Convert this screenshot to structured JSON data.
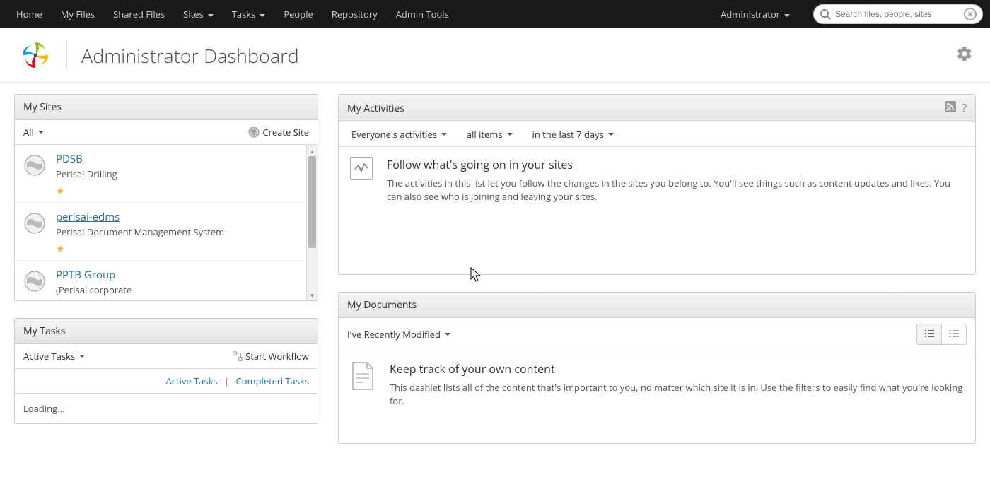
{
  "nav": {
    "home": "Home",
    "myFiles": "My Files",
    "sharedFiles": "Shared Files",
    "sites": "Sites",
    "tasks": "Tasks",
    "people": "People",
    "repository": "Repository",
    "adminTools": "Admin Tools",
    "user": "Administrator",
    "searchPlaceholder": "Search files, people, sites"
  },
  "header": {
    "title": "Administrator Dashboard"
  },
  "mySites": {
    "title": "My Sites",
    "filter": "All",
    "createSite": "Create Site",
    "items": [
      {
        "name": "PDSB",
        "desc": "Perisai Drilling"
      },
      {
        "name": "perisai-edms",
        "desc": "Perisai Document Management System"
      },
      {
        "name": "PPTB Group",
        "desc": "(Perisai corporate"
      }
    ]
  },
  "myTasks": {
    "title": "My Tasks",
    "filter": "Active Tasks",
    "startWorkflow": "Start Workflow",
    "activeLink": "Active Tasks",
    "completedLink": "Completed Tasks",
    "loading": "Loading..."
  },
  "myActivities": {
    "title": "My Activities",
    "filters": [
      "Everyone's activities",
      "all items",
      "in the last 7 days"
    ],
    "emptyTitle": "Follow what's going on in your sites",
    "emptyText": "The activities in this list let you follow the changes in the sites you belong to. You'll see things such as content updates and likes. You can also see who is joining and leaving your sites."
  },
  "myDocuments": {
    "title": "My Documents",
    "filter": "I've Recently Modified",
    "emptyTitle": "Keep track of your own content",
    "emptyText": "This dashlet lists all of the content that's important to you, no matter which site it is in. Use the filters to easily find what you're looking for."
  }
}
